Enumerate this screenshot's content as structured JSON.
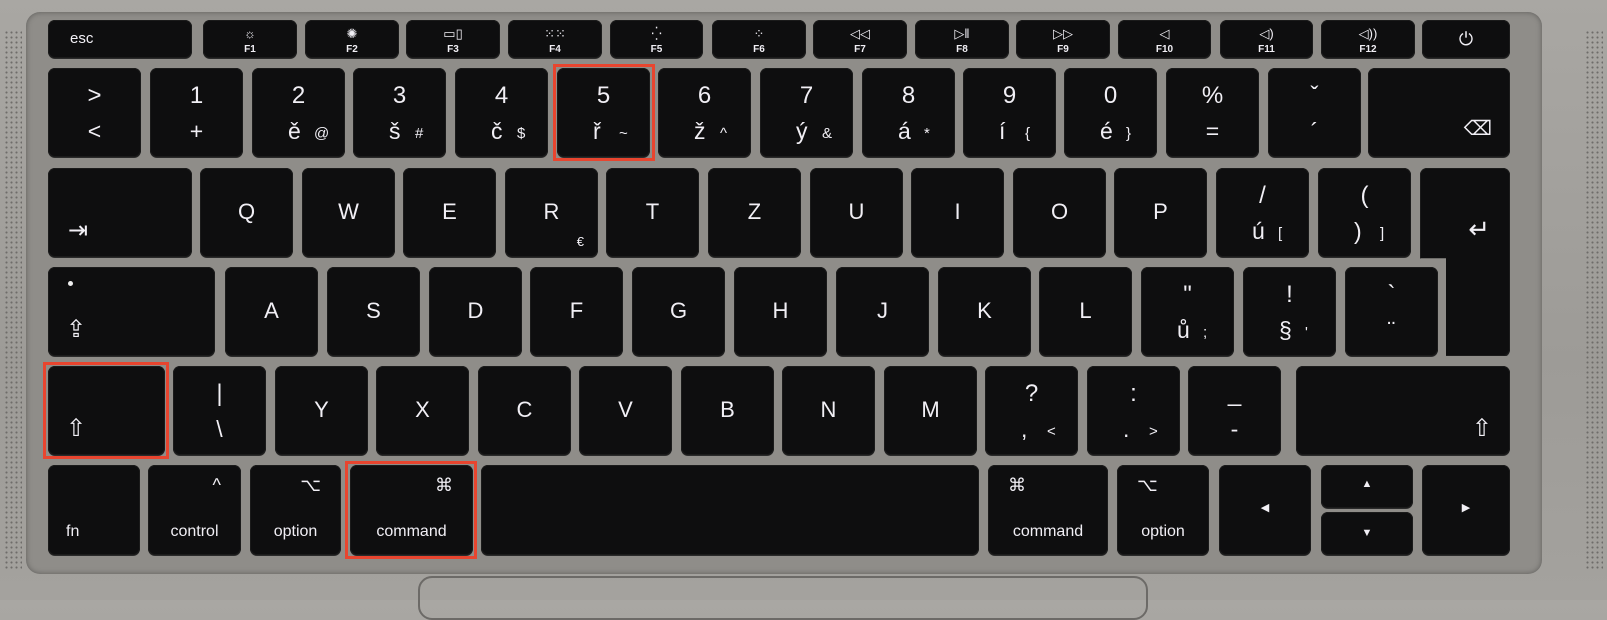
{
  "function_row": [
    {
      "label": "esc"
    },
    {
      "icon": "brightness-down-icon",
      "glyph": "☼",
      "label": "F1"
    },
    {
      "icon": "brightness-up-icon",
      "glyph": "✺",
      "label": "F2"
    },
    {
      "icon": "mission-control-icon",
      "glyph": "▭▯",
      "label": "F3"
    },
    {
      "icon": "launchpad-icon",
      "glyph": "⁙⁙",
      "label": "F4"
    },
    {
      "icon": "keyboard-brightness-down-icon",
      "glyph": "⁛",
      "label": "F5"
    },
    {
      "icon": "keyboard-brightness-up-icon",
      "glyph": "⁘",
      "label": "F6"
    },
    {
      "icon": "rewind-icon",
      "glyph": "◁◁",
      "label": "F7"
    },
    {
      "icon": "play-pause-icon",
      "glyph": "▷‖",
      "label": "F8"
    },
    {
      "icon": "fast-forward-icon",
      "glyph": "▷▷",
      "label": "F9"
    },
    {
      "icon": "mute-icon",
      "glyph": "◁",
      "label": "F10"
    },
    {
      "icon": "volume-down-icon",
      "glyph": "◁)",
      "label": "F11"
    },
    {
      "icon": "volume-up-icon",
      "glyph": "◁))",
      "label": "F12"
    },
    {
      "icon": "power-icon",
      "glyph": "⏻"
    }
  ],
  "number_row": [
    {
      "top": ">",
      "bl": "<",
      "br": ""
    },
    {
      "top": "1",
      "bl": "+",
      "br": ""
    },
    {
      "top": "2",
      "bl": "ě",
      "br": "@"
    },
    {
      "top": "3",
      "bl": "š",
      "br": "#"
    },
    {
      "top": "4",
      "bl": "č",
      "br": "$"
    },
    {
      "top": "5",
      "bl": "ř",
      "br": "~"
    },
    {
      "top": "6",
      "bl": "ž",
      "br": "^"
    },
    {
      "top": "7",
      "bl": "ý",
      "br": "&"
    },
    {
      "top": "8",
      "bl": "á",
      "br": "*"
    },
    {
      "top": "9",
      "bl": "í",
      "br": "{"
    },
    {
      "top": "0",
      "bl": "é",
      "br": "}"
    },
    {
      "top": "%",
      "bl": "=",
      "br": ""
    },
    {
      "top": "ˇ",
      "bl": "´",
      "br": ""
    },
    {
      "icon": "delete-icon",
      "glyph": "⌫"
    }
  ],
  "tab_row": [
    {
      "icon": "tab-icon",
      "glyph": "⇥"
    },
    {
      "main": "Q"
    },
    {
      "main": "W"
    },
    {
      "main": "E"
    },
    {
      "main": "R",
      "sub": "€"
    },
    {
      "main": "T"
    },
    {
      "main": "Z"
    },
    {
      "main": "U"
    },
    {
      "main": "I"
    },
    {
      "main": "O"
    },
    {
      "main": "P"
    },
    {
      "top": "/",
      "bl": "ú",
      "br": "["
    },
    {
      "top": "(",
      "bl": ")",
      "br": "]"
    },
    {
      "icon": "return-icon",
      "glyph": "↵"
    }
  ],
  "caps_row": [
    {
      "icon": "caps-lock-icon",
      "glyph": "⇪"
    },
    {
      "main": "A"
    },
    {
      "main": "S"
    },
    {
      "main": "D"
    },
    {
      "main": "F"
    },
    {
      "main": "G"
    },
    {
      "main": "H"
    },
    {
      "main": "J"
    },
    {
      "main": "K"
    },
    {
      "main": "L"
    },
    {
      "top": "\"",
      "bl": "ů",
      "br": ";"
    },
    {
      "top": "!",
      "bl": "§",
      "br": "'"
    },
    {
      "top": "`",
      "bl": "¨",
      "br": ""
    }
  ],
  "shift_row": [
    {
      "icon": "shift-icon",
      "glyph": "⇧"
    },
    {
      "top": "|",
      "bl": "\\",
      "br": ""
    },
    {
      "main": "Y"
    },
    {
      "main": "X"
    },
    {
      "main": "C"
    },
    {
      "main": "V"
    },
    {
      "main": "B"
    },
    {
      "main": "N"
    },
    {
      "main": "M"
    },
    {
      "top": "?",
      "bl": ",",
      "br": "<"
    },
    {
      "top": ":",
      "bl": ".",
      "br": ">"
    },
    {
      "top": "_",
      "bl": "-",
      "br": ""
    },
    {
      "icon": "shift-icon",
      "glyph": "⇧"
    }
  ],
  "bottom_row": [
    {
      "label": "fn"
    },
    {
      "label": "control",
      "glyph": "^"
    },
    {
      "label": "option",
      "glyph": "⌥"
    },
    {
      "label": "command",
      "glyph": "⌘"
    },
    {
      "label": ""
    },
    {
      "label": "command",
      "glyph": "⌘"
    },
    {
      "label": "option",
      "glyph": "⌥"
    },
    {
      "icon": "arrow-left-icon",
      "glyph": "◀"
    },
    {
      "icon": "arrow-up-icon",
      "glyph": "▲"
    },
    {
      "icon": "arrow-down-icon",
      "glyph": "▼"
    },
    {
      "icon": "arrow-right-icon",
      "glyph": "▶"
    }
  ],
  "highlight_color": "#e8452f"
}
